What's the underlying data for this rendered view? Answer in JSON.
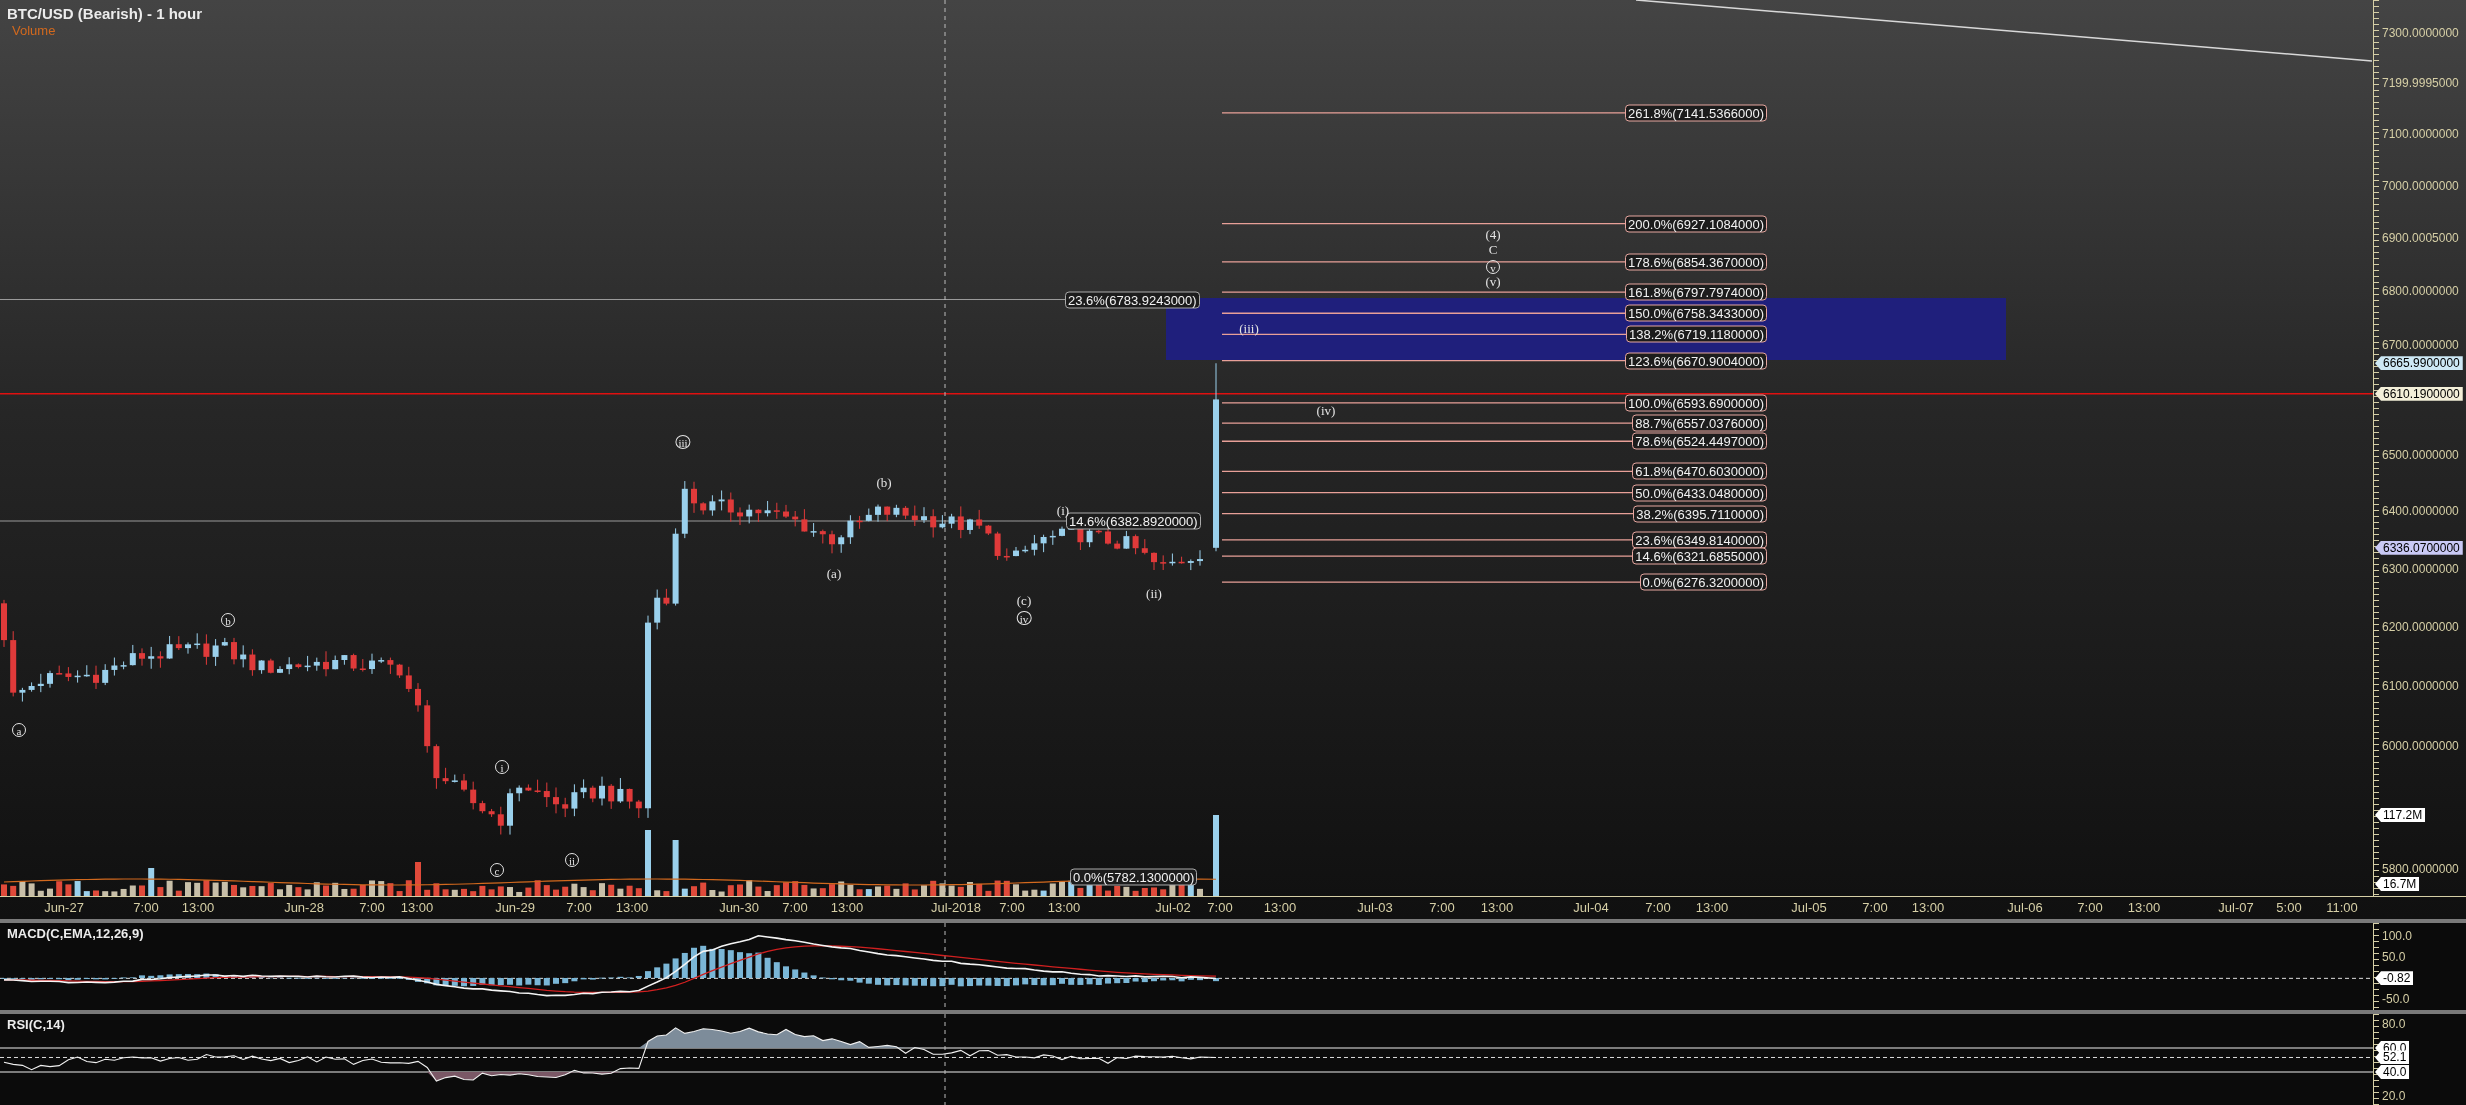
{
  "chart": {
    "title": "BTC/USD (Bearish) - 1 hour",
    "volume_label": "Volume",
    "price_axis": {
      "ticks": [
        "7300.0000000",
        "7199.9995000",
        "7100.0000000",
        "7000.0000000",
        "6900.0005000",
        "6800.0000000",
        "6700.0000000",
        "6500.0000000",
        "6400.0000000",
        "6300.0000000",
        "6200.0000000",
        "6100.0000000",
        "6000.0000000",
        "5800.0000000"
      ],
      "tags": [
        {
          "text": "6665.9900000",
          "color": "#cde8f5"
        },
        {
          "text": "6610.1900000",
          "color": "#f3efd8"
        },
        {
          "text": "6336.0700000",
          "color": "#c9c9f5"
        },
        {
          "text": "117.2M",
          "color": "#ffffff"
        },
        {
          "text": "16.7M",
          "color": "#ffffff"
        }
      ]
    },
    "time_axis": {
      "labels": [
        "Jun-27",
        "7:00",
        "13:00",
        "Jun-28",
        "7:00",
        "13:00",
        "Jun-29",
        "7:00",
        "13:00",
        "Jun-30",
        "7:00",
        "13:00",
        "Jul-2018",
        "7:00",
        "13:00",
        "Jul-02",
        "7:00",
        "13:00",
        "Jul-03",
        "7:00",
        "13:00",
        "Jul-04",
        "7:00",
        "13:00",
        "Jul-05",
        "7:00",
        "13:00",
        "Jul-06",
        "7:00",
        "13:00",
        "Jul-07",
        "5:00",
        "11:00"
      ]
    },
    "fib_levels": [
      "261.8%(7141.5366000)",
      "200.0%(6927.1084000)",
      "178.6%(6854.3670000)",
      "161.8%(6797.7974000)",
      "150.0%(6758.3433000)",
      "138.2%(6719.1180000)",
      "123.6%(6670.9004000)",
      "100.0%(6593.6900000)",
      "88.7%(6557.0376000)",
      "78.6%(6524.4497000)",
      "61.8%(6470.6030000)",
      "50.0%(6433.0480000)",
      "38.2%(6395.7110000)",
      "23.6%(6349.8140000)",
      "14.6%(6321.6855000)",
      "0.0%(6276.3200000)"
    ],
    "fib_markers": [
      "23.6%(6783.9243000)",
      "14.6%(6382.8920000)",
      "0.0%(5782.1300000)"
    ],
    "wave_labels": [
      {
        "text": "a",
        "circled": true
      },
      {
        "text": "b",
        "circled": true
      },
      {
        "text": "i",
        "circled": true
      },
      {
        "text": "c",
        "circled": true
      },
      {
        "text": "ii",
        "circled": true
      },
      {
        "text": "iii",
        "circled": true
      },
      {
        "text": "(a)",
        "circled": false
      },
      {
        "text": "(b)",
        "circled": false
      },
      {
        "text": "(c)",
        "circled": false
      },
      {
        "text": "iv",
        "circled": true
      },
      {
        "text": "(i)",
        "circled": false
      },
      {
        "text": "(ii)",
        "circled": false
      },
      {
        "text": "(iii)",
        "circled": false
      },
      {
        "text": "(iv)",
        "circled": false
      },
      {
        "text": "(4)",
        "circled": false
      },
      {
        "text": "C",
        "circled": false
      },
      {
        "text": "v",
        "circled": true
      },
      {
        "text": "(v)",
        "circled": false
      }
    ]
  },
  "macd": {
    "title": "MACD(C,EMA,12,26,9)",
    "ticks": [
      "100.0",
      "50.0",
      "-50.0"
    ],
    "tags": [
      "-0.82"
    ]
  },
  "rsi": {
    "title": "RSI(C,14)",
    "ticks": [
      "80.0",
      "20.0"
    ],
    "tags": [
      "60.0",
      "52.1",
      "40.0"
    ]
  }
}
